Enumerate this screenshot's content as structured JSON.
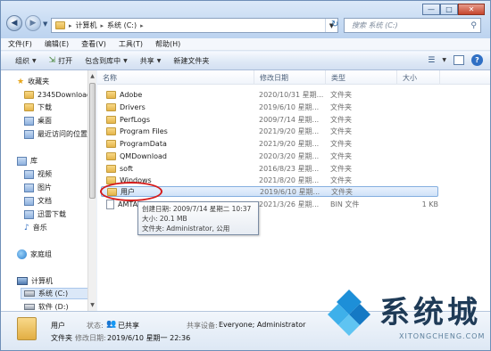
{
  "window": {
    "minimize_label": "—",
    "maximize_label": "□",
    "close_label": "✕"
  },
  "address": {
    "parts": [
      "计算机",
      "系统 (C:)"
    ],
    "search_placeholder": "搜索 系统 (C:)"
  },
  "menu": [
    "文件(F)",
    "编辑(E)",
    "查看(V)",
    "工具(T)",
    "帮助(H)"
  ],
  "toolbar": {
    "organize": "组织",
    "open": "打开",
    "include": "包含到库中",
    "share": "共享",
    "new_folder": "新建文件夹"
  },
  "sidebar": {
    "favorites": "收藏夹",
    "fav_items": [
      "2345Download",
      "下载",
      "桌面",
      "最近访问的位置"
    ],
    "libraries": "库",
    "lib_items": [
      "视频",
      "图片",
      "文档",
      "迅雷下载",
      "音乐"
    ],
    "homegroup": "家庭组",
    "computer": "计算机",
    "drives": [
      "系统 (C:)",
      "软件 (D:)"
    ]
  },
  "columns": {
    "name": "名称",
    "date": "修改日期",
    "type": "类型",
    "size": "大小"
  },
  "files": [
    {
      "name": "Adobe",
      "date": "2020/10/31 星期...",
      "type": "文件夹",
      "size": ""
    },
    {
      "name": "Drivers",
      "date": "2019/6/10 星期...",
      "type": "文件夹",
      "size": ""
    },
    {
      "name": "PerfLogs",
      "date": "2009/7/14 星期...",
      "type": "文件夹",
      "size": ""
    },
    {
      "name": "Program Files",
      "date": "2021/9/20 星期...",
      "type": "文件夹",
      "size": ""
    },
    {
      "name": "ProgramData",
      "date": "2021/9/20 星期...",
      "type": "文件夹",
      "size": ""
    },
    {
      "name": "QMDownload",
      "date": "2020/3/20 星期...",
      "type": "文件夹",
      "size": ""
    },
    {
      "name": "soft",
      "date": "2016/8/23 星期...",
      "type": "文件夹",
      "size": ""
    },
    {
      "name": "Windows",
      "date": "2021/8/20 星期...",
      "type": "文件夹",
      "size": ""
    },
    {
      "name": "用户",
      "date": "2019/6/10 星期...",
      "type": "文件夹",
      "size": ""
    },
    {
      "name": "AMTA",
      "date": "2021/3/26 星期...",
      "type": "BIN 文件",
      "size": "1 KB"
    }
  ],
  "tooltip": {
    "line1": "创建日期: 2009/7/14 星期二 10:37",
    "line2": "大小: 20.1 MB",
    "line3": "文件夹: Administrator, 公用"
  },
  "details": {
    "name": "用户",
    "state_label": "状态:",
    "state": "已共享",
    "type": "文件夹",
    "modified_label": "修改日期:",
    "modified": "2019/6/10 星期一 22:36",
    "shared_label": "共享设备:",
    "shared": "Everyone; Administrator"
  },
  "watermark": {
    "brand": "系统城",
    "url": "XITONGCHENG.COM"
  }
}
